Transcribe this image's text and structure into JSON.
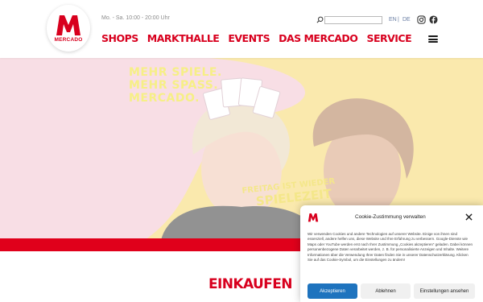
{
  "header": {
    "logo_text": "MERCADO",
    "hours": "Mo. - Sa. 10:00 - 20:00 Uhr",
    "nav": [
      "SHOPS",
      "MARKTHALLE",
      "EVENTS",
      "DAS MERCADO",
      "SERVICE"
    ],
    "search": {
      "value": "",
      "placeholder": ""
    },
    "languages": [
      "EN",
      "DE"
    ],
    "language_separator": "|",
    "icons": [
      "search-icon",
      "instagram-icon",
      "facebook-icon",
      "menu-icon",
      "accessibility-icon"
    ],
    "brand_color": "#d8001e"
  },
  "hero": {
    "slogan": [
      "MEHR SPIELE.",
      "MEHR SPASS.",
      "MERCADO."
    ],
    "caption": [
      "FREITAG IST WIEDER",
      "SPIELEZEIT"
    ]
  },
  "main": {
    "section_title": "EINKAUFEN"
  },
  "cookie": {
    "title": "Cookie-Zustimmung verwalten",
    "body": "Wir verwenden Cookies und andere Technologien auf unserer Website. Einige von ihnen sind essenziell, andere helfen uns, diese Website und Ihre Erfahrung zu verbessern. Google-Dienste wie Maps oder YouTube werden erst nach Ihrer Zustimmung „Cookies akzeptieren“ geladen. Dabei können personenbezogene Daten verarbeitet werden, z. B. für personalisierte Anzeigen und Inhalte. Weitere Informationen über die Verwendung Ihrer Daten finden Sie in unserer Datenschutzerklärung. Klicken Sie auf das Cookie-Symbol, um die Einstellungen zu ändern!",
    "accept": "Akzeptieren",
    "deny": "Ablehnen",
    "preferences": "Einstellungen ansehen",
    "accent_color": "#1e73be"
  }
}
